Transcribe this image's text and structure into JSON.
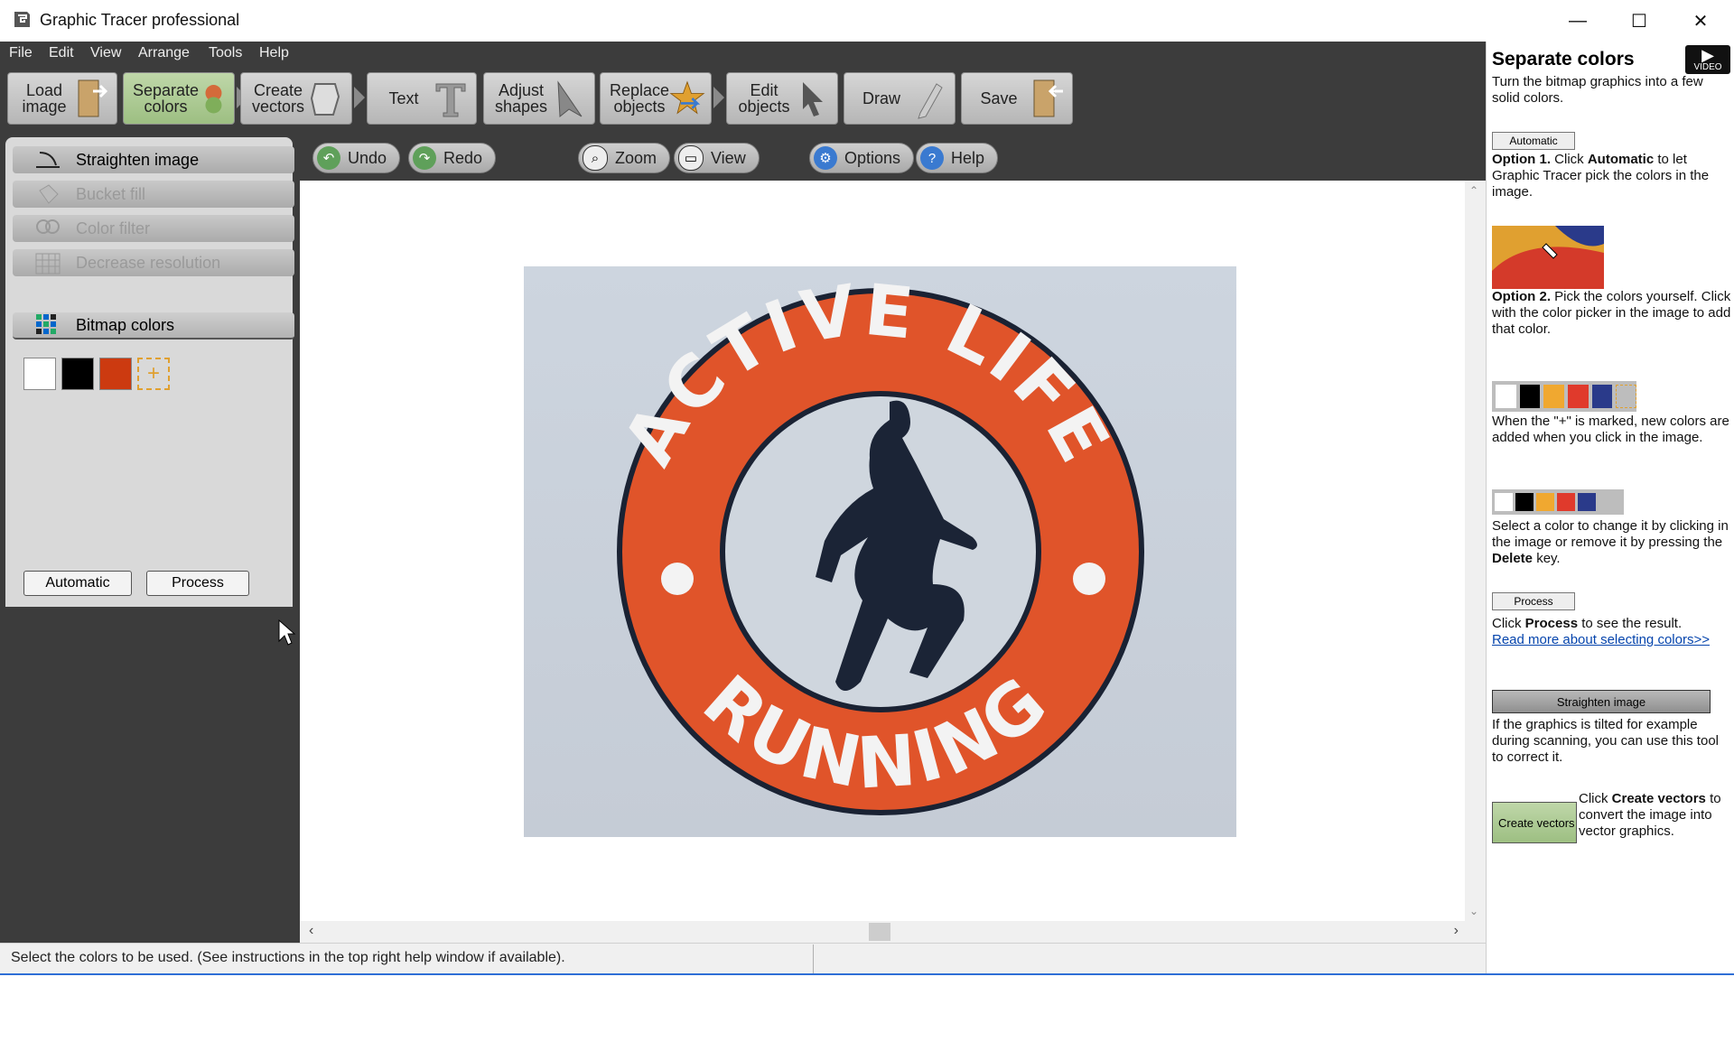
{
  "window": {
    "title": "Graphic Tracer professional",
    "minimize": "—",
    "maximize": "☐",
    "close": "✕"
  },
  "menu": [
    "File",
    "Edit",
    "View",
    "Arrange",
    "Tools",
    "Help"
  ],
  "toolbar": [
    {
      "label": "Load\nimage",
      "icon": "door-icon"
    },
    {
      "label": "Separate\ncolors",
      "icon": "color-separate-icon",
      "active": true
    },
    {
      "label": "Create\nvectors",
      "icon": "vector-shape-icon"
    },
    {
      "label": "Text",
      "icon": "text-t-icon"
    },
    {
      "label": "Adjust\nshapes",
      "icon": "arrow-pointer-icon"
    },
    {
      "label": "Replace\nobjects",
      "icon": "star-replace-icon"
    },
    {
      "label": "Edit\nobjects",
      "icon": "cursor-icon"
    },
    {
      "label": "Draw",
      "icon": "pencil-icon"
    },
    {
      "label": "Save",
      "icon": "door-save-icon"
    }
  ],
  "secondary_toolbar": {
    "undo": "Undo",
    "redo": "Redo",
    "zoom": "Zoom",
    "view": "View",
    "options": "Options",
    "help": "Help"
  },
  "left_panel": {
    "tools": [
      {
        "label": "Straighten image",
        "enabled": true
      },
      {
        "label": "Bucket fill",
        "enabled": false
      },
      {
        "label": "Color filter",
        "enabled": false
      },
      {
        "label": "Decrease resolution",
        "enabled": false
      }
    ],
    "bitmap_colors_title": "Bitmap colors",
    "swatches": [
      "#ffffff",
      "#000000",
      "#cc3a10"
    ],
    "automatic": "Automatic",
    "process": "Process"
  },
  "canvas_image": {
    "top_text": "ACTIVE LIFE",
    "bottom_text": "RUNNING",
    "ring_color": "#e0542a"
  },
  "status_text": "Select the colors to be used. (See instructions in the top right help window if available).",
  "help": {
    "title": "Separate colors",
    "video_label": "VIDEO",
    "subtitle": "Turn the bitmap graphics into a few solid colors.",
    "automatic_btn": "Automatic",
    "option1_bold": "Option 1.",
    "option1_pre": "Click",
    "option1_bold2": "Automatic",
    "option1_post": "to let Graphic Tracer pick the colors in the image.",
    "option2_bold": "Option 2.",
    "option2_text": "Pick the colors yourself. Click with the color picker in the image to add that color.",
    "plus_text": "When the \"+\" is marked, new colors are added when you click in the image.",
    "select_text_pre": "Select a color to change it by clicking in the image or remove it by pressing the",
    "select_text_bold": "Delete",
    "select_text_post": "key.",
    "process_btn": "Process",
    "process_pre": "Click",
    "process_bold": "Process",
    "process_post": "to see the result.",
    "read_more": "Read more about selecting colors>>",
    "straighten_btn": "Straighten image",
    "straighten_text": "If the graphics is tilted for example during scanning, you can use this tool to correct it.",
    "create_btn": "Create vectors",
    "create_pre": "Click",
    "create_bold": "Create vectors",
    "create_post": "to convert the image into vector graphics.",
    "palette_colors": [
      "#ffffff",
      "#000000",
      "#f0a830",
      "#e03a2c",
      "#2a3a8a"
    ]
  }
}
